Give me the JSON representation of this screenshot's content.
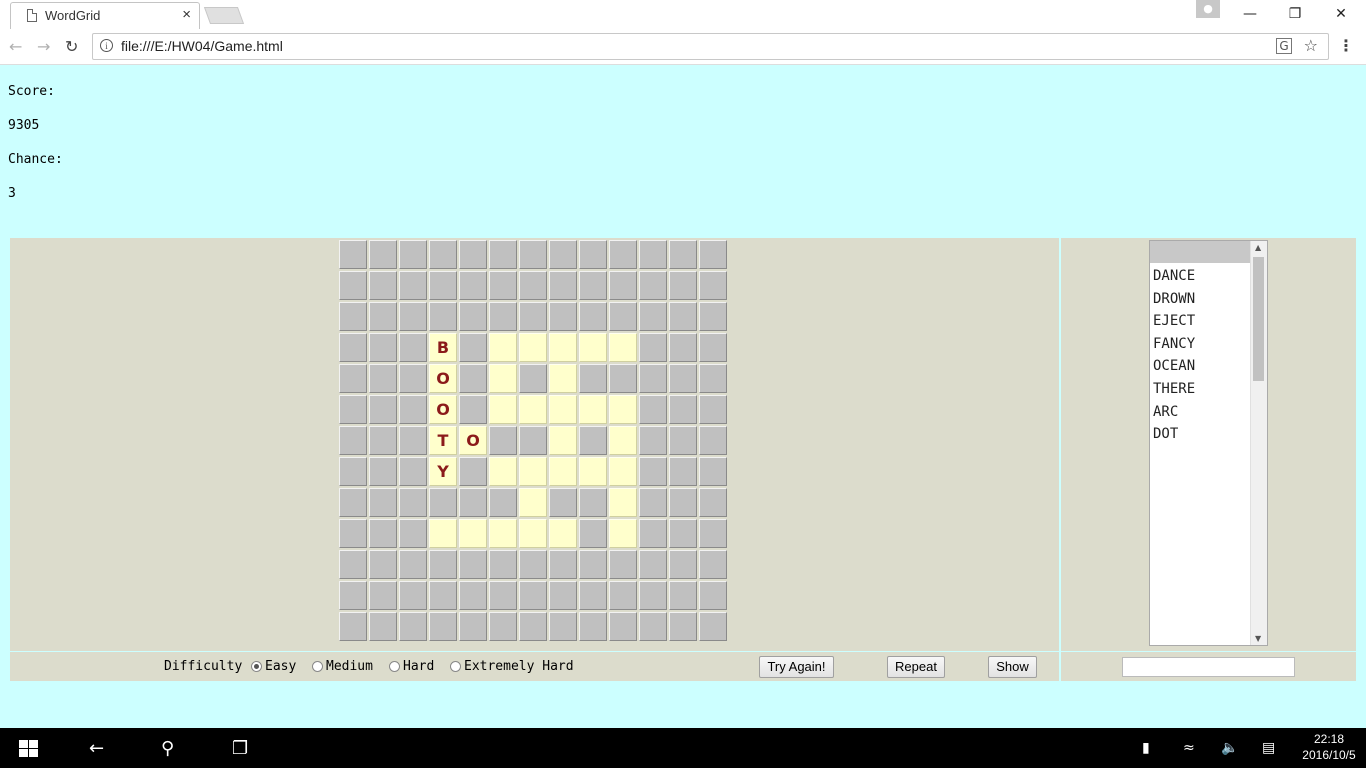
{
  "browser": {
    "tab_title": "WordGrid",
    "tab_close": "×",
    "user_icon": "person-icon",
    "window_minimize": "—",
    "window_restore": "❐",
    "window_close": "✕",
    "back": "←",
    "forward": "→",
    "reload": "↻",
    "url": "file:///E:/HW04/Game.html",
    "translate_icon": "translate-icon",
    "bookmark_star": "☆",
    "menu": "⋮"
  },
  "game": {
    "score_label": "Score:",
    "score_value": "9305",
    "chance_label": "Chance:",
    "chance_value": "3",
    "grid": {
      "rows": 13,
      "cols": 13,
      "cell_color": "#c0c0c0",
      "open_color": "#ffffcc",
      "letter_color": "#8b1a1a",
      "open_cells": [
        [
          3,
          3
        ],
        [
          3,
          5
        ],
        [
          3,
          6
        ],
        [
          3,
          7
        ],
        [
          3,
          8
        ],
        [
          3,
          9
        ],
        [
          4,
          3
        ],
        [
          4,
          5
        ],
        [
          4,
          7
        ],
        [
          5,
          3
        ],
        [
          5,
          5
        ],
        [
          5,
          6
        ],
        [
          5,
          7
        ],
        [
          5,
          8
        ],
        [
          5,
          9
        ],
        [
          6,
          3
        ],
        [
          6,
          4
        ],
        [
          6,
          7
        ],
        [
          6,
          9
        ],
        [
          7,
          3
        ],
        [
          7,
          5
        ],
        [
          7,
          6
        ],
        [
          7,
          7
        ],
        [
          7,
          8
        ],
        [
          7,
          9
        ],
        [
          8,
          6
        ],
        [
          8,
          9
        ],
        [
          9,
          3
        ],
        [
          9,
          4
        ],
        [
          9,
          5
        ],
        [
          9,
          6
        ],
        [
          9,
          7
        ],
        [
          9,
          9
        ]
      ],
      "letters": [
        {
          "row": 3,
          "col": 3,
          "ch": "B"
        },
        {
          "row": 4,
          "col": 3,
          "ch": "O"
        },
        {
          "row": 5,
          "col": 3,
          "ch": "O"
        },
        {
          "row": 6,
          "col": 3,
          "ch": "T"
        },
        {
          "row": 6,
          "col": 4,
          "ch": "O"
        },
        {
          "row": 7,
          "col": 3,
          "ch": "Y"
        }
      ]
    },
    "words": [
      "DANCE",
      "DROWN",
      "EJECT",
      "FANCY",
      "OCEAN",
      "THERE",
      "ARC",
      "DOT"
    ],
    "difficulty_label": "Difficulty",
    "difficulty_options": [
      "Easy",
      "Medium",
      "Hard",
      "Extremely Hard"
    ],
    "difficulty_selected": "Easy",
    "try_again_label": "Try Again!",
    "repeat_label": "Repeat",
    "show_label": "Show",
    "answer_value": ""
  },
  "taskbar": {
    "time": "22:18",
    "date": "2016/10/5"
  }
}
